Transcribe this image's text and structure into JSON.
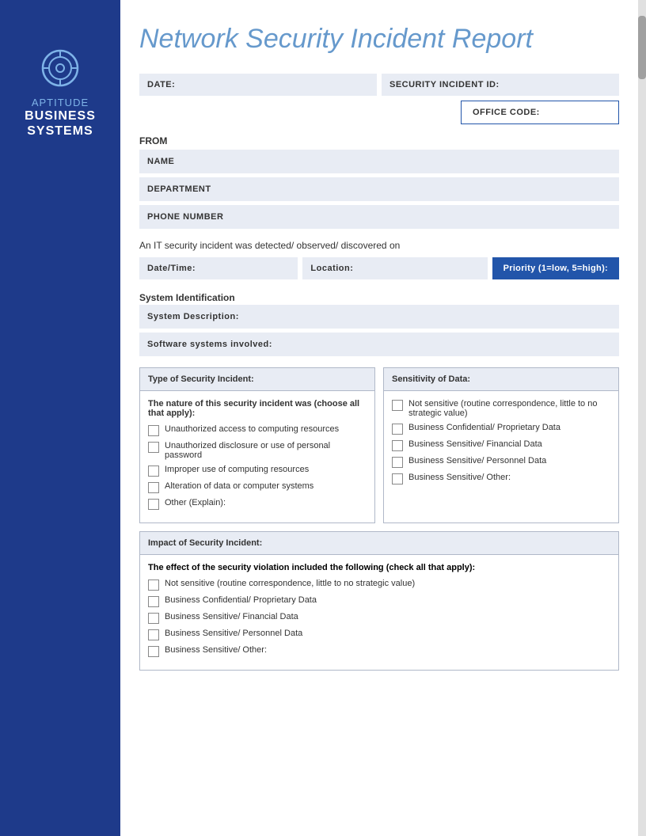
{
  "sidebar": {
    "icon_label": "target-icon",
    "title_top": "APTITUDE",
    "title_main_line1": "BUSINESS",
    "title_main_line2": "SYSTEMS"
  },
  "header": {
    "report_title": "Network Security Incident Report"
  },
  "form": {
    "date_label": "DATE:",
    "security_incident_id_label": "SECURITY INCIDENT ID:",
    "office_code_label": "OFFICE CODE:",
    "from_label": "FROM",
    "name_label": "NAME",
    "department_label": "DEPARTMENT",
    "phone_label": "PHONE NUMBER",
    "incident_detected_text": "An IT security incident was detected/ observed/ discovered on",
    "datetime_label": "Date/Time:",
    "location_label": "Location:",
    "priority_label": "Priority (1=low, 5=high):",
    "system_identification_label": "System Identification",
    "system_description_label": "System Description:",
    "software_systems_label": "Software systems involved:",
    "type_of_incident_label": "Type of Security Incident:",
    "nature_text": "The nature of this security incident was (choose all that apply):",
    "checkboxes_incident": [
      "Unauthorized access to computing resources",
      "Unauthorized disclosure or use of personal password",
      "Improper use of computing resources",
      "Alteration of data or computer systems",
      "Other (Explain):"
    ],
    "sensitivity_label": "Sensitivity of Data:",
    "sensitivity_items": [
      "Not sensitive (routine correspondence, little to no strategic value)",
      "Business Confidential/ Proprietary Data",
      "Business Sensitive/ Financial Data",
      "Business Sensitive/ Personnel Data",
      "Business Sensitive/ Other:"
    ],
    "impact_label": "Impact of Security Incident:",
    "effect_text": "The effect of the security violation included the following (check all that apply):",
    "impact_items": [
      "Not sensitive (routine correspondence, little to no strategic value)",
      "Business Confidential/ Proprietary Data",
      "Business Sensitive/ Financial Data",
      "Business Sensitive/ Personnel Data",
      "Business Sensitive/ Other:"
    ]
  }
}
